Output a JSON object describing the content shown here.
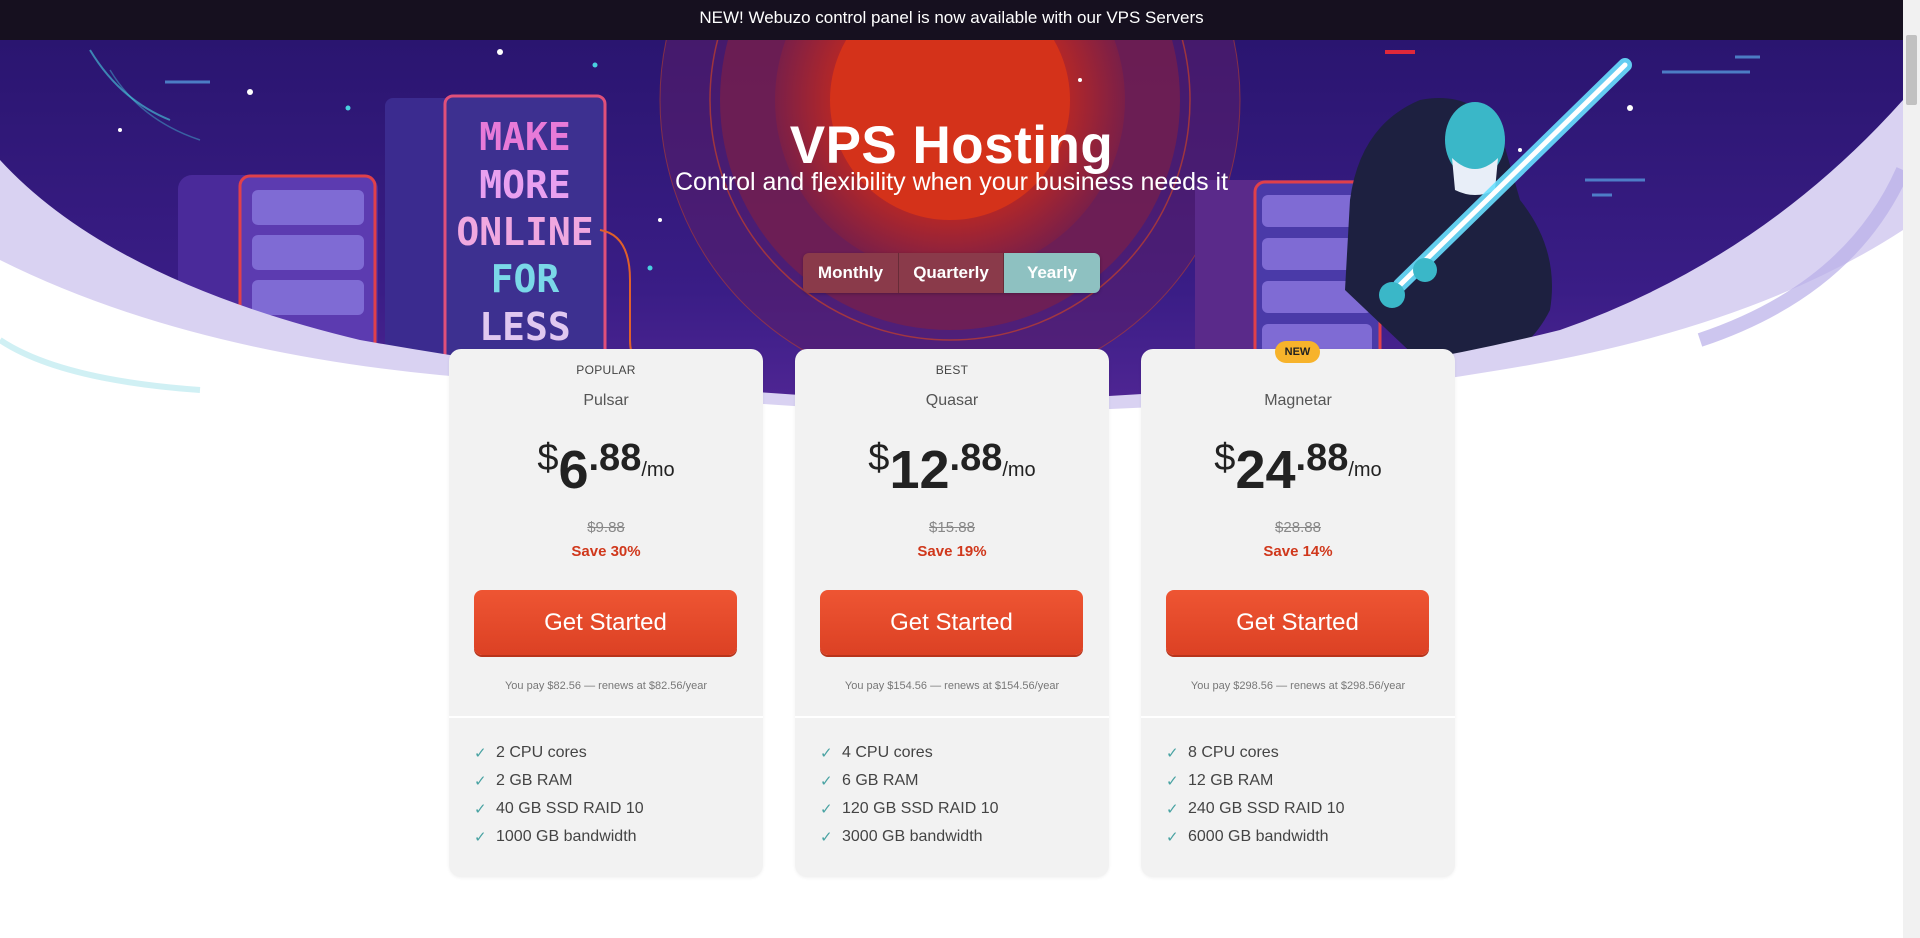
{
  "announcement": "NEW! Webuzo control panel is now available with our VPS Servers",
  "hero": {
    "title": "VPS Hosting",
    "subtitle": "Control and flexibility when your business needs it",
    "sign_lines": [
      "MAKE",
      "MORE",
      "ONLINE",
      "FOR",
      "LESS"
    ]
  },
  "billing_toggle": {
    "options": [
      "Monthly",
      "Quarterly",
      "Yearly"
    ],
    "selected": "Yearly"
  },
  "colors": {
    "accent": "#e24a2a",
    "toggle_active": "#8ec1c1",
    "save_text": "#d0381c",
    "badge": "#f7b32b",
    "check": "#4aa3a3"
  },
  "plans": [
    {
      "kicker": "POPULAR",
      "badge": "",
      "name": "Pulsar",
      "currency": "$",
      "price_int": "6",
      "price_dec": ".88",
      "per": "/mo",
      "original": "$9.88",
      "save": "Save 30%",
      "cta": "Get Started",
      "renew": "You pay $82.56 — renews at $82.56/year",
      "features": [
        "2 CPU cores",
        "2 GB RAM",
        "40 GB SSD RAID 10",
        "1000 GB bandwidth"
      ]
    },
    {
      "kicker": "BEST",
      "badge": "",
      "name": "Quasar",
      "currency": "$",
      "price_int": "12",
      "price_dec": ".88",
      "per": "/mo",
      "original": "$15.88",
      "save": "Save 19%",
      "cta": "Get Started",
      "renew": "You pay $154.56 — renews at $154.56/year",
      "features": [
        "4 CPU cores",
        "6 GB RAM",
        "120 GB SSD RAID 10",
        "3000 GB bandwidth"
      ]
    },
    {
      "kicker": "",
      "badge": "NEW",
      "name": "Magnetar",
      "currency": "$",
      "price_int": "24",
      "price_dec": ".88",
      "per": "/mo",
      "original": "$28.88",
      "save": "Save 14%",
      "cta": "Get Started",
      "renew": "You pay $298.56 — renews at $298.56/year",
      "features": [
        "8 CPU cores",
        "12 GB RAM",
        "240 GB SSD RAID 10",
        "6000 GB bandwidth"
      ]
    }
  ],
  "icons": {
    "check": "check-icon"
  }
}
